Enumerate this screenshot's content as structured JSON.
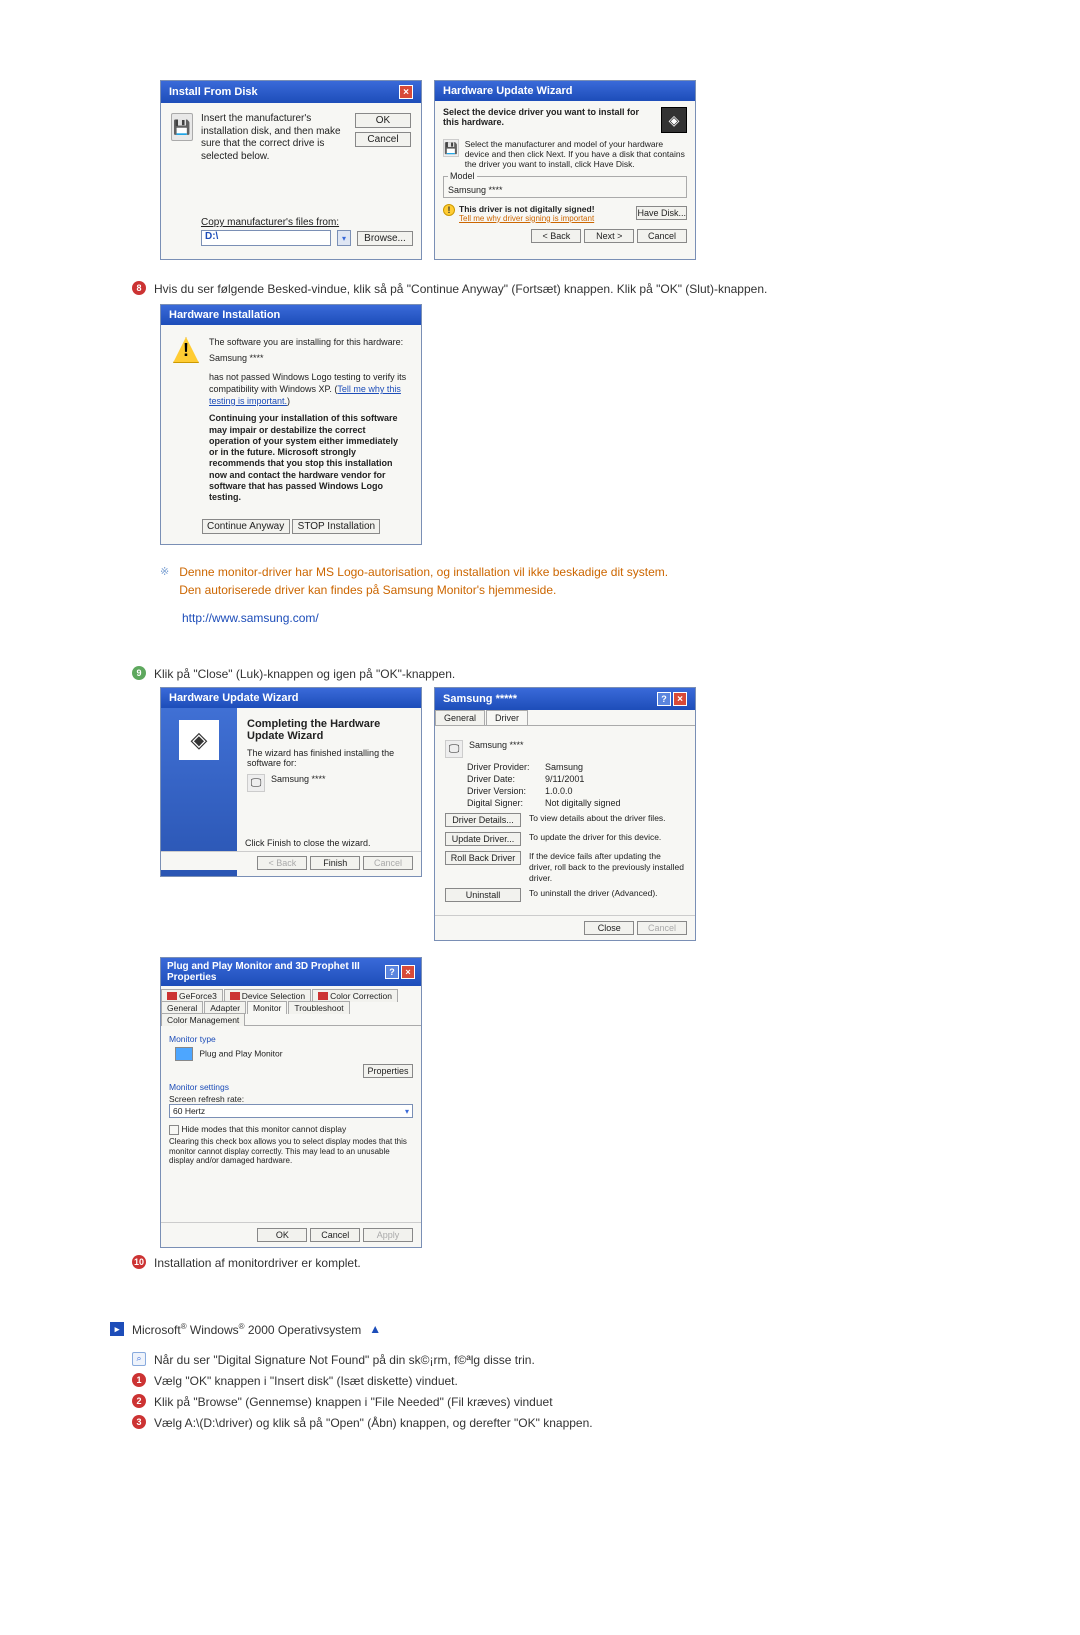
{
  "install_from_disk": {
    "title": "Install From Disk",
    "instruction": "Insert the manufacturer's installation disk, and then make sure that the correct drive is selected below.",
    "ok": "OK",
    "cancel": "Cancel",
    "copy_label": "Copy manufacturer's files from:",
    "drive_value": "D:\\",
    "browse": "Browse..."
  },
  "hw_update_select": {
    "title": "Hardware Update Wizard",
    "heading": "Select the device driver you want to install for this hardware.",
    "sub": "Select the manufacturer and model of your hardware device and then click Next. If you have a disk that contains the driver you want to install, click Have Disk.",
    "model_label": "Model",
    "model_value": "Samsung ****",
    "warn": "This driver is not digitally signed!",
    "warn_link": "Tell me why driver signing is important",
    "have_disk": "Have Disk...",
    "back": "< Back",
    "next": "Next >",
    "cancel": "Cancel"
  },
  "step8": {
    "n": "8",
    "text": "Hvis du ser følgende Besked-vindue, klik så på \"Continue Anyway\" (Fortsæt) knappen. Klik på \"OK\" (Slut)-knappen."
  },
  "hw_install": {
    "title": "Hardware Installation",
    "line1": "The software you are installing for this hardware:",
    "device": "Samsung ****",
    "line2a": "has not passed Windows Logo testing to verify its compatibility with Windows XP. (",
    "line2_link": "Tell me why this testing is important.",
    "line2b": ")",
    "bold": "Continuing your installation of this software may impair or destabilize the correct operation of your system either immediately or in the future. Microsoft strongly recommends that you stop this installation now and contact the hardware vendor for software that has passed Windows Logo testing.",
    "btn_continue": "Continue Anyway",
    "btn_stop": "STOP Installation"
  },
  "note": {
    "text1": "Denne monitor-driver har MS Logo-autorisation, og installation vil ikke beskadige dit system.",
    "text2": "Den autoriserede driver kan findes på Samsung Monitor's hjemmeside.",
    "url": "http://www.samsung.com/"
  },
  "step9": {
    "n": "9",
    "text": "Klik på \"Close\" (Luk)-knappen og igen på \"OK\"-knappen."
  },
  "complete_wizard": {
    "title": "Hardware Update Wizard",
    "heading": "Completing the Hardware Update Wizard",
    "sub": "The wizard has finished installing the software for:",
    "device": "Samsung ****",
    "finish_msg": "Click Finish to close the wizard.",
    "back": "< Back",
    "finish": "Finish",
    "cancel": "Cancel"
  },
  "driver_props": {
    "title": "Samsung *****",
    "tab_general": "General",
    "tab_driver": "Driver",
    "device": "Samsung ****",
    "provider_l": "Driver Provider:",
    "provider_v": "Samsung",
    "date_l": "Driver Date:",
    "date_v": "9/11/2001",
    "version_l": "Driver Version:",
    "version_v": "1.0.0.0",
    "signer_l": "Digital Signer:",
    "signer_v": "Not digitally signed",
    "btn_details": "Driver Details...",
    "txt_details": "To view details about the driver files.",
    "btn_update": "Update Driver...",
    "txt_update": "To update the driver for this device.",
    "btn_rollback": "Roll Back Driver",
    "txt_rollback": "If the device fails after updating the driver, roll back to the previously installed driver.",
    "btn_uninstall": "Uninstall",
    "txt_uninstall": "To uninstall the driver (Advanced).",
    "close": "Close",
    "cancel": "Cancel"
  },
  "monitor_props": {
    "title": "Plug and Play Monitor and 3D Prophet III Properties",
    "t_geforce": "GeForce3",
    "t_devsel": "Device Selection",
    "t_colorcorr": "Color Correction",
    "t_general": "General",
    "t_adapter": "Adapter",
    "t_monitor": "Monitor",
    "t_trouble": "Troubleshoot",
    "t_colormgmt": "Color Management",
    "mtype": "Monitor type",
    "mname": "Plug and Play Monitor",
    "props_btn": "Properties",
    "msettings": "Monitor settings",
    "refresh": "Screen refresh rate:",
    "refresh_v": "60 Hertz",
    "hide": "Hide modes that this monitor cannot display",
    "hide_note": "Clearing this check box allows you to select display modes that this monitor cannot display correctly. This may lead to an unusable display and/or damaged hardware.",
    "ok": "OK",
    "cancel": "Cancel",
    "apply": "Apply"
  },
  "step10": {
    "n": "10",
    "text": "Installation af monitordriver er komplet."
  },
  "section_w2k": {
    "prefix": "Microsoft",
    "mid": " Windows",
    "suffix": " 2000 Operativsystem"
  },
  "w2k_info": "Når du ser \"Digital Signature Not Found\" på din sk©¡rm, f©ªlg disse trin.",
  "w2k_s1": {
    "n": "1",
    "text": "Vælg \"OK\" knappen i \"Insert disk\" (Isæt diskette) vinduet."
  },
  "w2k_s2": {
    "n": "2",
    "text": "Klik på \"Browse\" (Gennemse) knappen i \"File Needed\" (Fil kræves) vinduet"
  },
  "w2k_s3": {
    "n": "3",
    "text": "Vælg A:\\(D:\\driver) og klik så på \"Open\" (Åbn) knappen, og derefter \"OK\" knappen."
  }
}
